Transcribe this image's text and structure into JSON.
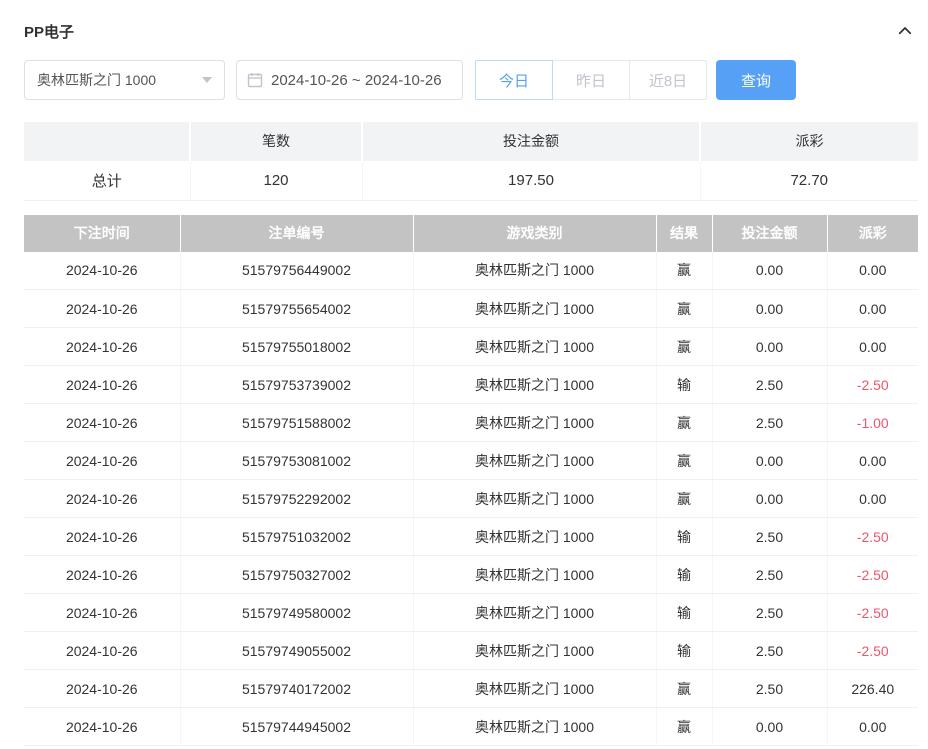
{
  "header": {
    "title": "PP电子"
  },
  "filters": {
    "game_select": {
      "value": "奥林匹斯之门 1000"
    },
    "date_range": {
      "value": "2024-10-26 ~ 2024-10-26"
    },
    "quick_buttons": [
      {
        "label": "今日",
        "active": true
      },
      {
        "label": "昨日",
        "active": false
      },
      {
        "label": "近8日",
        "active": false
      }
    ],
    "search_button": "查询"
  },
  "summary_table": {
    "headers": [
      "",
      "笔数",
      "投注金额",
      "派彩"
    ],
    "row": {
      "label": "总计",
      "count": "120",
      "bet_amount": "197.50",
      "payout": "72.70"
    }
  },
  "detail_table": {
    "headers": [
      "下注时间",
      "注单编号",
      "游戏类别",
      "结果",
      "投注金额",
      "派彩"
    ],
    "rows": [
      {
        "date": "2024-10-26",
        "order_id": "51579756449002",
        "game": "奥林匹斯之门 1000",
        "result": "赢",
        "bet": "0.00",
        "payout": "0.00"
      },
      {
        "date": "2024-10-26",
        "order_id": "51579755654002",
        "game": "奥林匹斯之门 1000",
        "result": "赢",
        "bet": "0.00",
        "payout": "0.00"
      },
      {
        "date": "2024-10-26",
        "order_id": "51579755018002",
        "game": "奥林匹斯之门 1000",
        "result": "赢",
        "bet": "0.00",
        "payout": "0.00"
      },
      {
        "date": "2024-10-26",
        "order_id": "51579753739002",
        "game": "奥林匹斯之门 1000",
        "result": "输",
        "bet": "2.50",
        "payout": "-2.50"
      },
      {
        "date": "2024-10-26",
        "order_id": "51579751588002",
        "game": "奥林匹斯之门 1000",
        "result": "赢",
        "bet": "2.50",
        "payout": "-1.00"
      },
      {
        "date": "2024-10-26",
        "order_id": "51579753081002",
        "game": "奥林匹斯之门 1000",
        "result": "赢",
        "bet": "0.00",
        "payout": "0.00"
      },
      {
        "date": "2024-10-26",
        "order_id": "51579752292002",
        "game": "奥林匹斯之门 1000",
        "result": "赢",
        "bet": "0.00",
        "payout": "0.00"
      },
      {
        "date": "2024-10-26",
        "order_id": "51579751032002",
        "game": "奥林匹斯之门 1000",
        "result": "输",
        "bet": "2.50",
        "payout": "-2.50"
      },
      {
        "date": "2024-10-26",
        "order_id": "51579750327002",
        "game": "奥林匹斯之门 1000",
        "result": "输",
        "bet": "2.50",
        "payout": "-2.50"
      },
      {
        "date": "2024-10-26",
        "order_id": "51579749580002",
        "game": "奥林匹斯之门 1000",
        "result": "输",
        "bet": "2.50",
        "payout": "-2.50"
      },
      {
        "date": "2024-10-26",
        "order_id": "51579749055002",
        "game": "奥林匹斯之门 1000",
        "result": "输",
        "bet": "2.50",
        "payout": "-2.50"
      },
      {
        "date": "2024-10-26",
        "order_id": "51579740172002",
        "game": "奥林匹斯之门 1000",
        "result": "赢",
        "bet": "2.50",
        "payout": "226.40"
      },
      {
        "date": "2024-10-26",
        "order_id": "51579744945002",
        "game": "奥林匹斯之门 1000",
        "result": "赢",
        "bet": "0.00",
        "payout": "0.00"
      }
    ]
  },
  "colors": {
    "accent": "#56a0f5",
    "negative": "#f0566a",
    "table_header_bg": "#c3c3c3",
    "summary_header_bg": "#f2f3f5"
  }
}
